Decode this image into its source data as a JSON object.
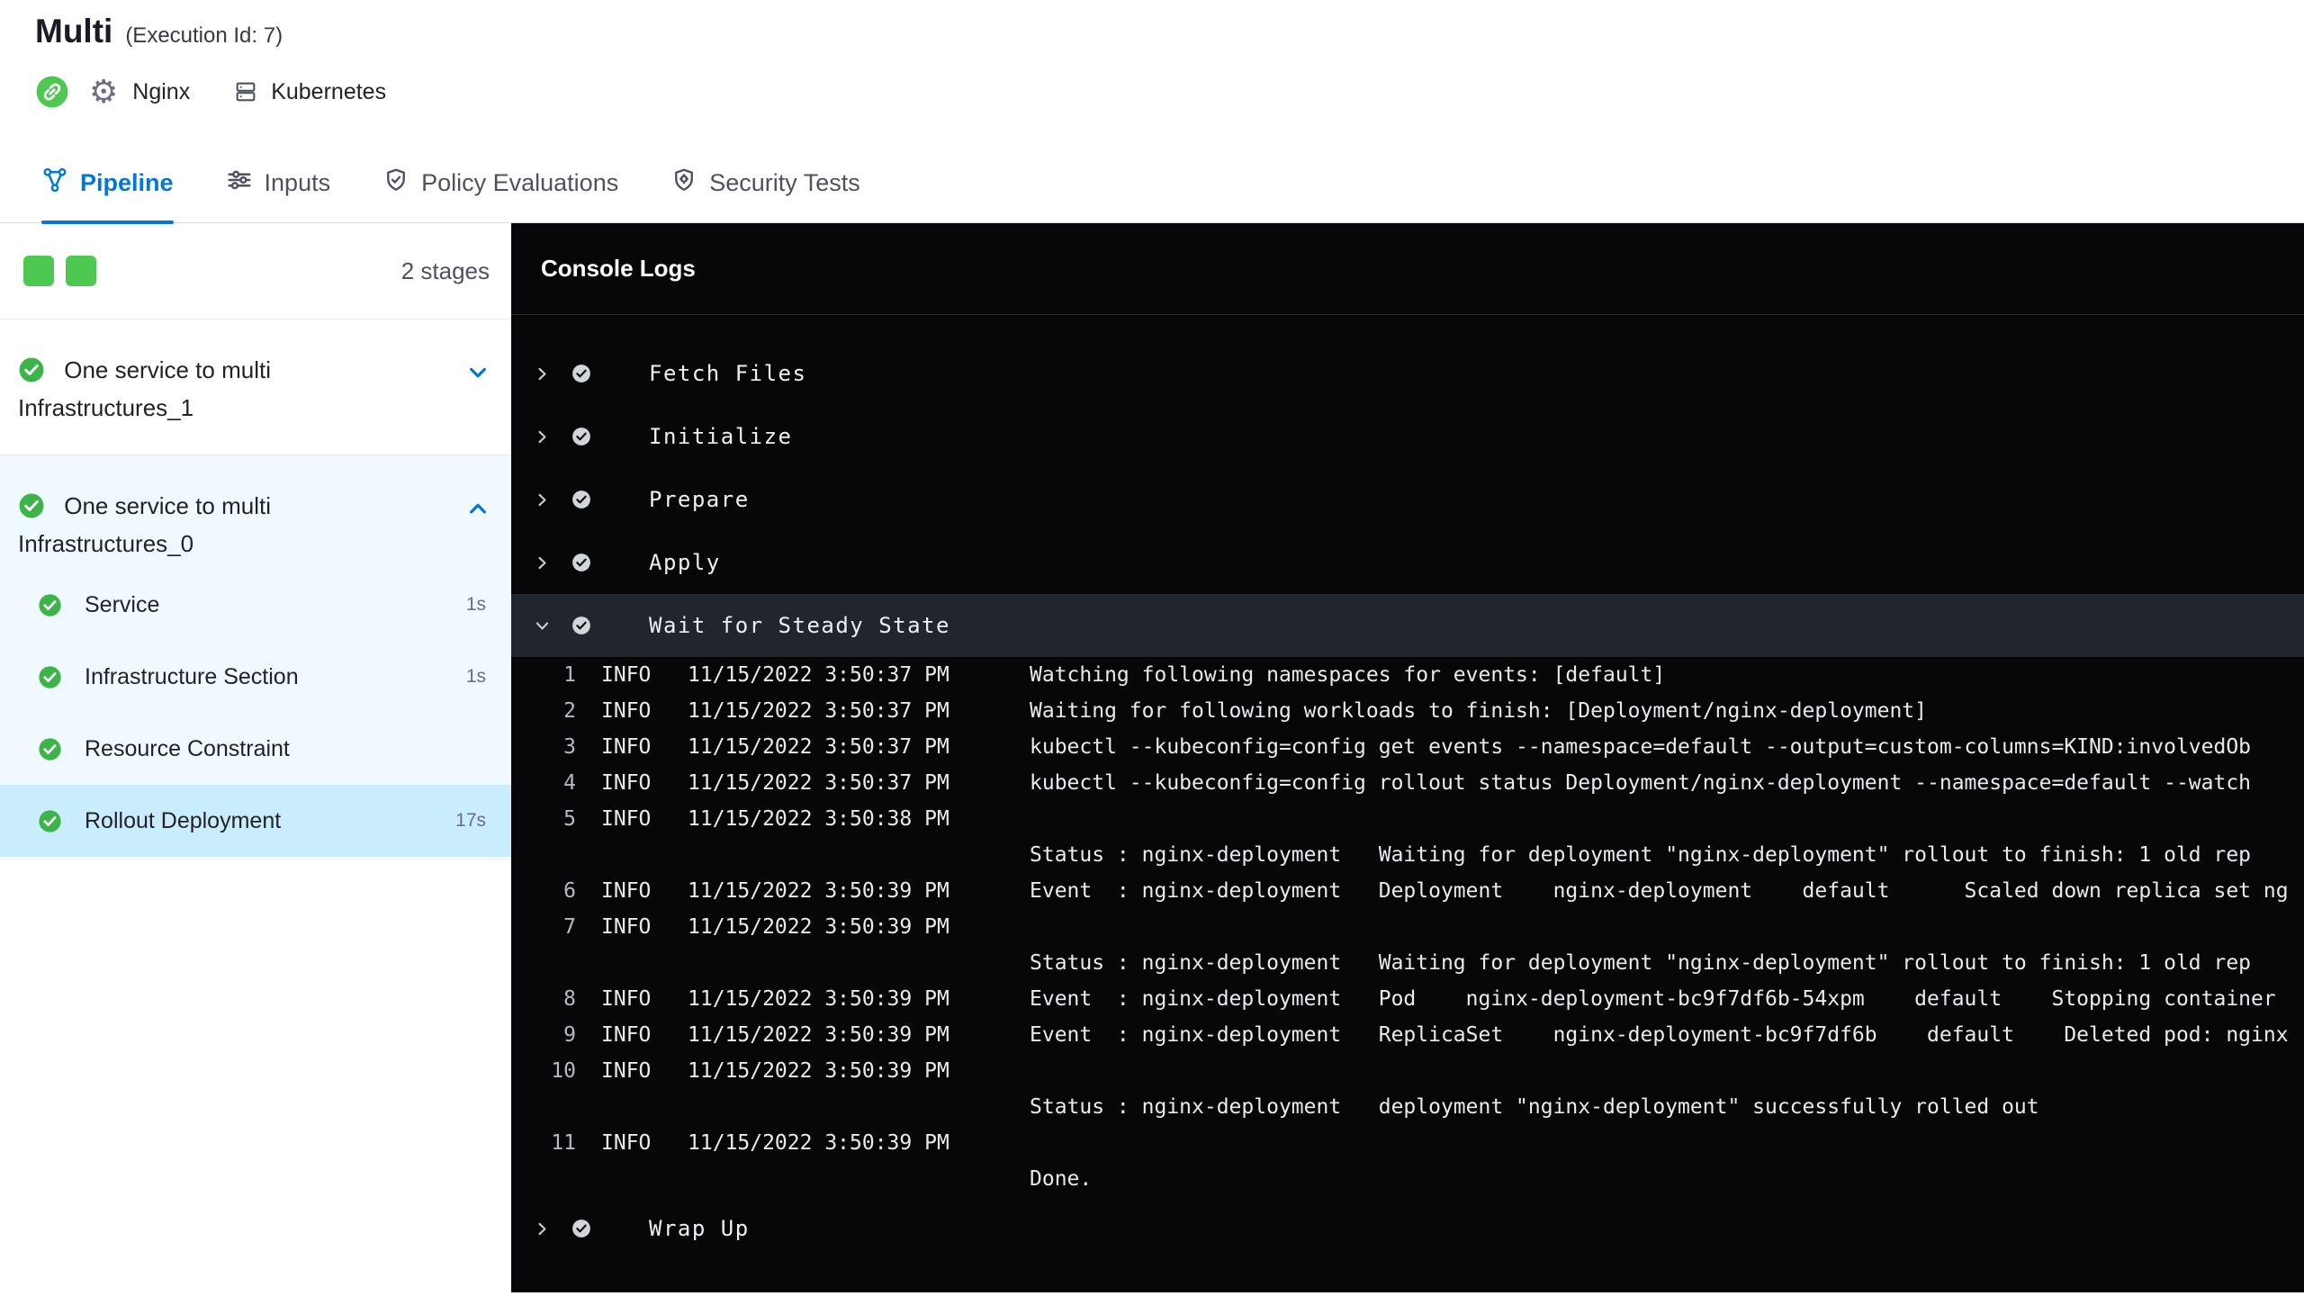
{
  "header": {
    "title": "Multi",
    "execution_id": "(Execution Id: 7)",
    "service_name": "Nginx",
    "environment_name": "Kubernetes"
  },
  "icons": {
    "gear": "⚙"
  },
  "tabs": [
    {
      "label": "Pipeline",
      "active": true
    },
    {
      "label": "Inputs",
      "active": false
    },
    {
      "label": "Policy Evaluations",
      "active": false
    },
    {
      "label": "Security Tests",
      "active": false
    }
  ],
  "sidebar": {
    "stages_count": "2 stages",
    "stages": [
      {
        "name": "One service to multi Infrastructures_1",
        "status": "success",
        "expanded": false
      },
      {
        "name": "One service to multi Infrastructures_0",
        "status": "success",
        "expanded": true,
        "steps": [
          {
            "name": "Service",
            "duration": "1s",
            "status": "success",
            "selected": false
          },
          {
            "name": "Infrastructure Section",
            "duration": "1s",
            "status": "success",
            "selected": false
          },
          {
            "name": "Resource Constraint",
            "duration": "",
            "status": "success",
            "selected": false
          },
          {
            "name": "Rollout Deployment",
            "duration": "17s",
            "status": "success",
            "selected": true
          }
        ]
      }
    ]
  },
  "console": {
    "title": "Console Logs",
    "sections": [
      {
        "title": "Fetch Files",
        "status": "success",
        "expanded": false
      },
      {
        "title": "Initialize",
        "status": "success",
        "expanded": false
      },
      {
        "title": "Prepare",
        "status": "success",
        "expanded": false
      },
      {
        "title": "Apply",
        "status": "success",
        "expanded": false
      },
      {
        "title": "Wait for Steady State",
        "status": "success",
        "expanded": true
      },
      {
        "title": "Wrap Up",
        "status": "success",
        "expanded": false
      }
    ],
    "log_rows": [
      {
        "num": "1",
        "level": "INFO",
        "time": "11/15/2022 3:50:37 PM",
        "msg": "Watching following namespaces for events: [default]"
      },
      {
        "num": "2",
        "level": "INFO",
        "time": "11/15/2022 3:50:37 PM",
        "msg": "Waiting for following workloads to finish: [Deployment/nginx-deployment]"
      },
      {
        "num": "3",
        "level": "INFO",
        "time": "11/15/2022 3:50:37 PM",
        "msg": "kubectl --kubeconfig=config get events --namespace=default --output=custom-columns=KIND:involvedOb"
      },
      {
        "num": "4",
        "level": "INFO",
        "time": "11/15/2022 3:50:37 PM",
        "msg": "kubectl --kubeconfig=config rollout status Deployment/nginx-deployment --namespace=default --watch"
      },
      {
        "num": "5",
        "level": "INFO",
        "time": "11/15/2022 3:50:38 PM",
        "msg": ""
      },
      {
        "num": "",
        "level": "",
        "time": "",
        "msg": "Status : nginx-deployment   Waiting for deployment \"nginx-deployment\" rollout to finish: 1 old rep"
      },
      {
        "num": "6",
        "level": "INFO",
        "time": "11/15/2022 3:50:39 PM",
        "msg": "Event  : nginx-deployment   Deployment    nginx-deployment    default      Scaled down replica set ng"
      },
      {
        "num": "7",
        "level": "INFO",
        "time": "11/15/2022 3:50:39 PM",
        "msg": ""
      },
      {
        "num": "",
        "level": "",
        "time": "",
        "msg": "Status : nginx-deployment   Waiting for deployment \"nginx-deployment\" rollout to finish: 1 old rep"
      },
      {
        "num": "8",
        "level": "INFO",
        "time": "11/15/2022 3:50:39 PM",
        "msg": "Event  : nginx-deployment   Pod    nginx-deployment-bc9f7df6b-54xpm    default    Stopping container"
      },
      {
        "num": "9",
        "level": "INFO",
        "time": "11/15/2022 3:50:39 PM",
        "msg": "Event  : nginx-deployment   ReplicaSet    nginx-deployment-bc9f7df6b    default    Deleted pod: nginx"
      },
      {
        "num": "10",
        "level": "INFO",
        "time": "11/15/2022 3:50:39 PM",
        "msg": ""
      },
      {
        "num": "",
        "level": "",
        "time": "",
        "msg": "Status : nginx-deployment   deployment \"nginx-deployment\" successfully rolled out"
      },
      {
        "num": "11",
        "level": "INFO",
        "time": "11/15/2022 3:50:39 PM",
        "msg": ""
      },
      {
        "num": "",
        "level": "",
        "time": "",
        "msg": "Done."
      }
    ]
  },
  "colors": {
    "accent_blue": "#0278D5",
    "success_green": "#3CB44A",
    "stage_square_green": "#4DC952",
    "console_bg": "#070709",
    "expanded_section_bg": "#20262C",
    "expanded_stage_bg": "#EFF9FF",
    "selected_step_bg": "#C9EDFC"
  }
}
